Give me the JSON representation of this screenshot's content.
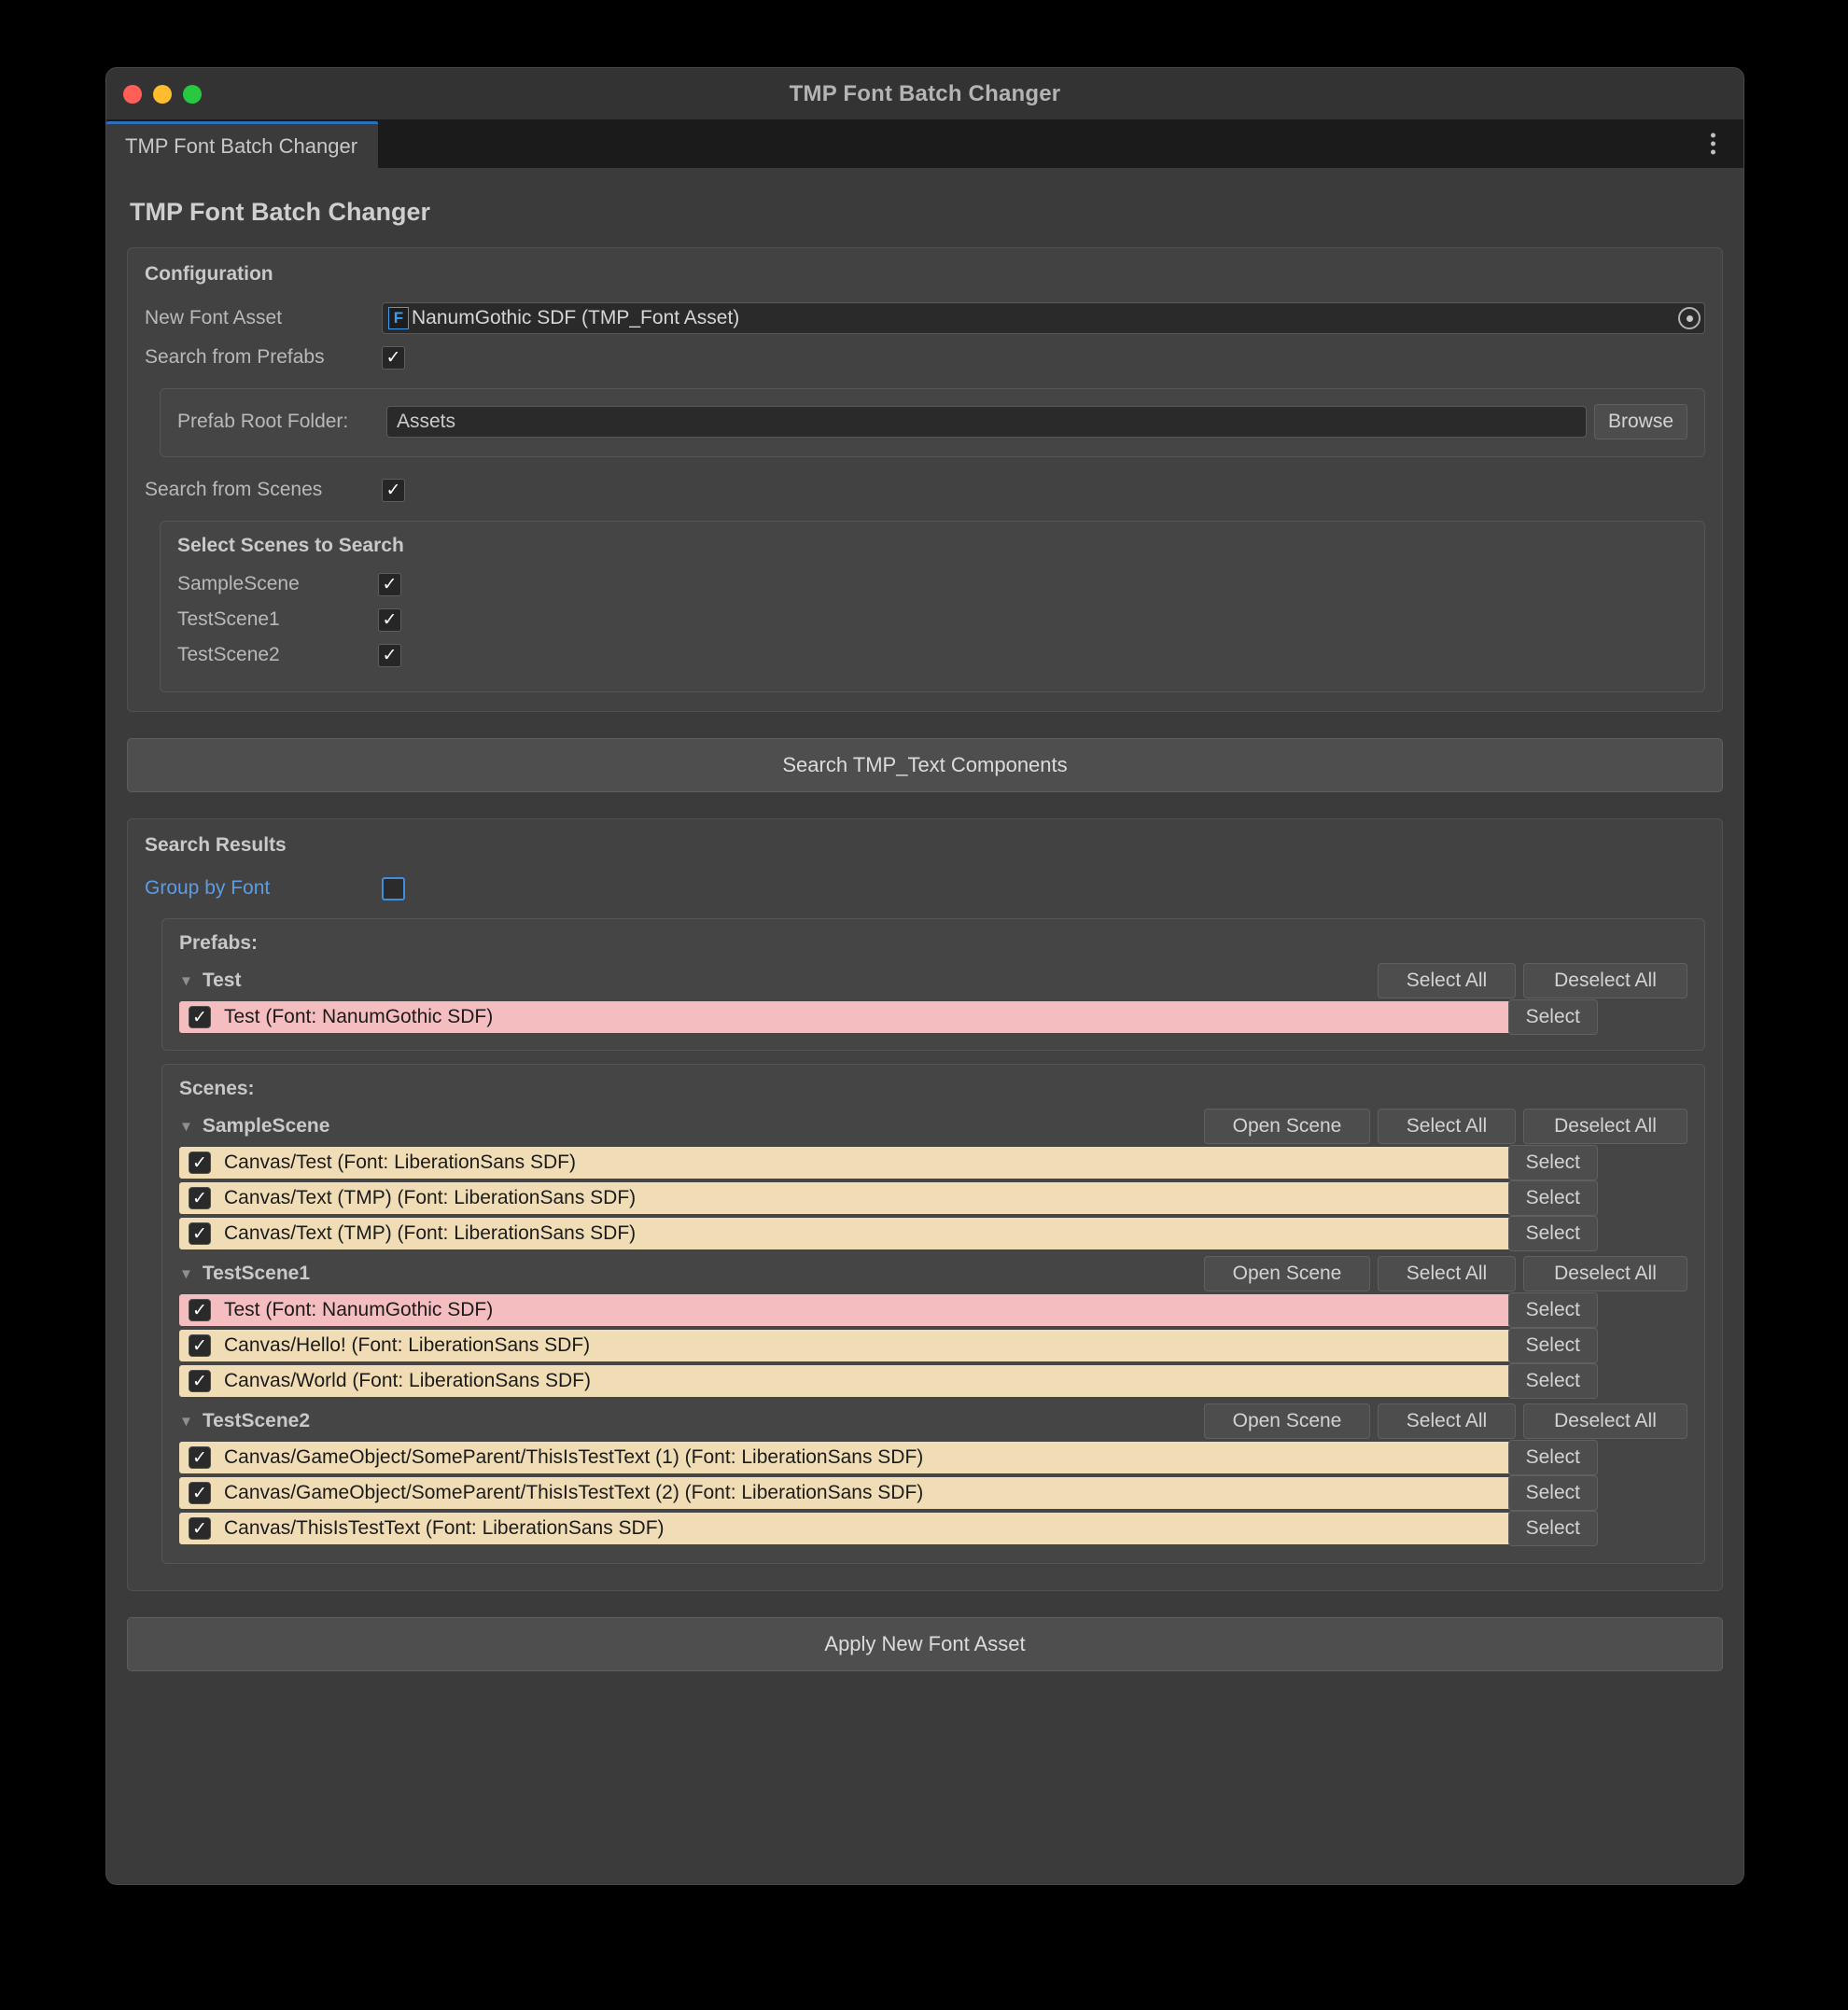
{
  "window": {
    "title": "TMP Font Batch Changer",
    "traffic_lights": [
      "close-button",
      "minimize-button",
      "maximize-button"
    ]
  },
  "tab": {
    "label": "TMP Font Batch Changer",
    "menu_icon": "kebab-menu-icon"
  },
  "page_title": "TMP Font Batch Changer",
  "colors": {
    "accent_blue": "#3e8ee0",
    "tab_active_border": "#2c6fbb",
    "row_cream": "#f0ddb6",
    "row_pink": "#f4bdc0",
    "panel_bg": "#424242",
    "window_bg": "#383838"
  },
  "configuration": {
    "title": "Configuration",
    "new_font_asset": {
      "label": "New Font Asset",
      "icon": "F",
      "value": "NanumGothic SDF (TMP_Font Asset)",
      "picker_icon": "target-picker-icon"
    },
    "search_from_prefabs": {
      "label": "Search from Prefabs",
      "checked": true
    },
    "prefab_root_folder": {
      "label": "Prefab Root Folder:",
      "value": "Assets",
      "placeholder": "Assets",
      "browse_label": "Browse"
    },
    "search_from_scenes": {
      "label": "Search from Scenes",
      "checked": true
    },
    "scene_select": {
      "title": "Select Scenes to Search",
      "scenes": [
        {
          "name": "SampleScene",
          "checked": true
        },
        {
          "name": "TestScene1",
          "checked": true
        },
        {
          "name": "TestScene2",
          "checked": true
        }
      ]
    }
  },
  "search_button_label": "Search TMP_Text Components",
  "search_results": {
    "title": "Search Results",
    "group_by_font": {
      "label": "Group by Font",
      "checked": false
    },
    "buttons": {
      "select_all": "Select All",
      "deselect_all": "Deselect All",
      "select": "Select",
      "open_scene": "Open Scene"
    },
    "prefabs": {
      "label": "Prefabs:",
      "groups": [
        {
          "name": "Test",
          "expanded": true,
          "has_open_scene": false,
          "items": [
            {
              "text": "Test (Font: NanumGothic SDF)",
              "checked": true,
              "highlight": "pink"
            }
          ]
        }
      ]
    },
    "scenes": {
      "label": "Scenes:",
      "groups": [
        {
          "name": "SampleScene",
          "expanded": true,
          "has_open_scene": true,
          "items": [
            {
              "text": "Canvas/Test (Font: LiberationSans SDF)",
              "checked": true,
              "highlight": "cream"
            },
            {
              "text": "Canvas/Text (TMP) (Font: LiberationSans SDF)",
              "checked": true,
              "highlight": "cream"
            },
            {
              "text": "Canvas/Text (TMP) (Font: LiberationSans SDF)",
              "checked": true,
              "highlight": "cream"
            }
          ]
        },
        {
          "name": "TestScene1",
          "expanded": true,
          "has_open_scene": true,
          "items": [
            {
              "text": "Test (Font: NanumGothic SDF)",
              "checked": true,
              "highlight": "pink"
            },
            {
              "text": "Canvas/Hello! (Font: LiberationSans SDF)",
              "checked": true,
              "highlight": "cream"
            },
            {
              "text": "Canvas/World (Font: LiberationSans SDF)",
              "checked": true,
              "highlight": "cream"
            }
          ]
        },
        {
          "name": "TestScene2",
          "expanded": true,
          "has_open_scene": true,
          "items": [
            {
              "text": "Canvas/GameObject/SomeParent/ThisIsTestText (1) (Font: LiberationSans SDF)",
              "checked": true,
              "highlight": "cream"
            },
            {
              "text": "Canvas/GameObject/SomeParent/ThisIsTestText (2) (Font: LiberationSans SDF)",
              "checked": true,
              "highlight": "cream"
            },
            {
              "text": "Canvas/ThisIsTestText (Font: LiberationSans SDF)",
              "checked": true,
              "highlight": "cream"
            }
          ]
        }
      ]
    }
  },
  "apply_button_label": "Apply New Font Asset"
}
